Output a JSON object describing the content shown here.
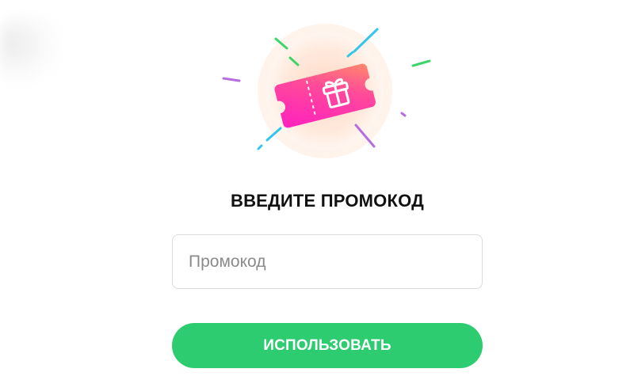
{
  "title": "ВВЕДИТЕ ПРОМОКОД",
  "promo_input": {
    "placeholder": "Промокод",
    "value": ""
  },
  "apply_button": {
    "label": "ИСПОЛЬЗОВАТЬ"
  },
  "illustration": {
    "icon": "gift-ticket-icon"
  },
  "colors": {
    "accent_green": "#2ecc71",
    "ticket_pink": "#ff2fa8",
    "ticket_orange": "#ff7a59",
    "glow_peach": "#ffe3cf"
  }
}
